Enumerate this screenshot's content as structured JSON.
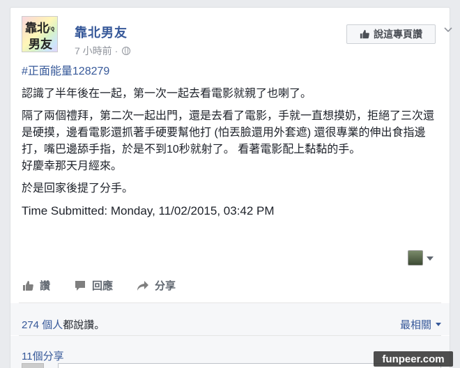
{
  "post": {
    "page_name": "靠北男友",
    "avatar_text_top": "靠北",
    "avatar_text_bottom": "男友",
    "avatar_badge": "FQ",
    "time": "7 小時前 ·",
    "like_page_label": "說這專頁讚",
    "hashtag": "#正面能量128279",
    "paragraphs": [
      "認識了半年後在一起，第一次一起去看電影就親了也喇了。",
      "隔了兩個禮拜，第二次一起出門，還是去看了電影，手就一直想摸奶，拒絕了三次還是硬摸，邊看電影還抓著手硬要幫他打 (怕丟臉還用外套遮) 還很專業的伸出食指邊打，嘴巴邊舔手指，於是不到10秒就射了。 看著電影配上黏黏的手。\n好慶幸那天月經來。",
      "於是回家後提了分手。"
    ],
    "submitted": "Time Submitted: Monday, 11/02/2015, 03:42 PM"
  },
  "actions": {
    "like": "讚",
    "comment": "回應",
    "share": "分享"
  },
  "stats": {
    "likes_count": "274 個人",
    "likes_suffix": "都說讚。",
    "sort_label": "最相關",
    "shares": "11個分享"
  },
  "watermark": "funpeer.com",
  "colors": {
    "link": "#365899",
    "text": "#1d2129",
    "muted": "#90949c"
  }
}
